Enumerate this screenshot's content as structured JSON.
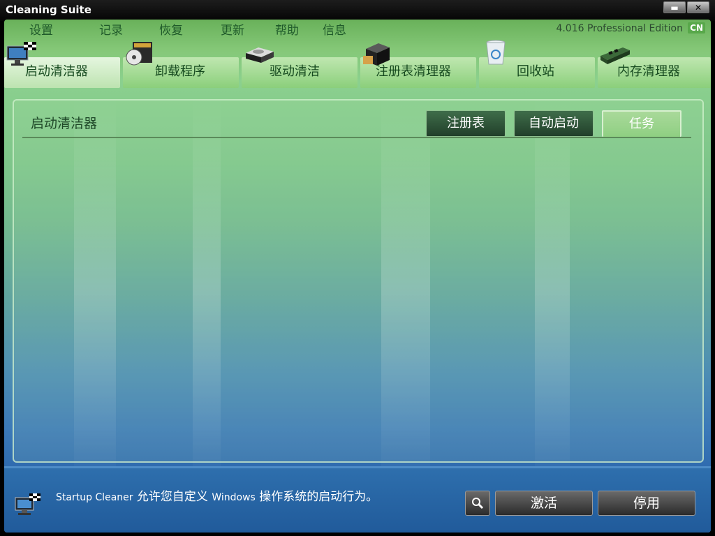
{
  "window": {
    "title": "Cleaning Suite",
    "minimize_glyph": "▬",
    "close_glyph": "✕"
  },
  "menu": {
    "items": [
      "设置",
      "记录",
      "恢复",
      "更新",
      "帮助",
      "信息"
    ],
    "edition": "4.016 Professional Edition",
    "language": "CN"
  },
  "nav": {
    "tabs": [
      {
        "label": "启动清洁器",
        "icon": "monitor-flag-icon",
        "active": true
      },
      {
        "label": "卸载程序",
        "icon": "disc-box-icon",
        "active": false
      },
      {
        "label": "驱动清洁",
        "icon": "drive-icon",
        "active": false
      },
      {
        "label": "注册表清理器",
        "icon": "registry-cube-icon",
        "active": false
      },
      {
        "label": "回收站",
        "icon": "recycle-bin-icon",
        "active": false
      },
      {
        "label": "内存清理器",
        "icon": "memory-module-icon",
        "active": false
      }
    ]
  },
  "panel": {
    "title": "启动清洁器",
    "subtabs": [
      {
        "label": "注册表",
        "active": false
      },
      {
        "label": "自动启动",
        "active": false
      },
      {
        "label": "任务",
        "active": true
      }
    ]
  },
  "status": {
    "icon": "monitor-flag-icon",
    "text_en": "Startup Cleaner",
    "text_cn1": "允许您自定义",
    "text_en2": "Windows",
    "text_cn2": "操作系统的启动行为。"
  },
  "buttons": {
    "search_icon": "search-icon",
    "activate": "激活",
    "disable": "停用"
  },
  "colors": {
    "accent_green": "#69b15a",
    "bottom_blue": "#2e6fad"
  }
}
